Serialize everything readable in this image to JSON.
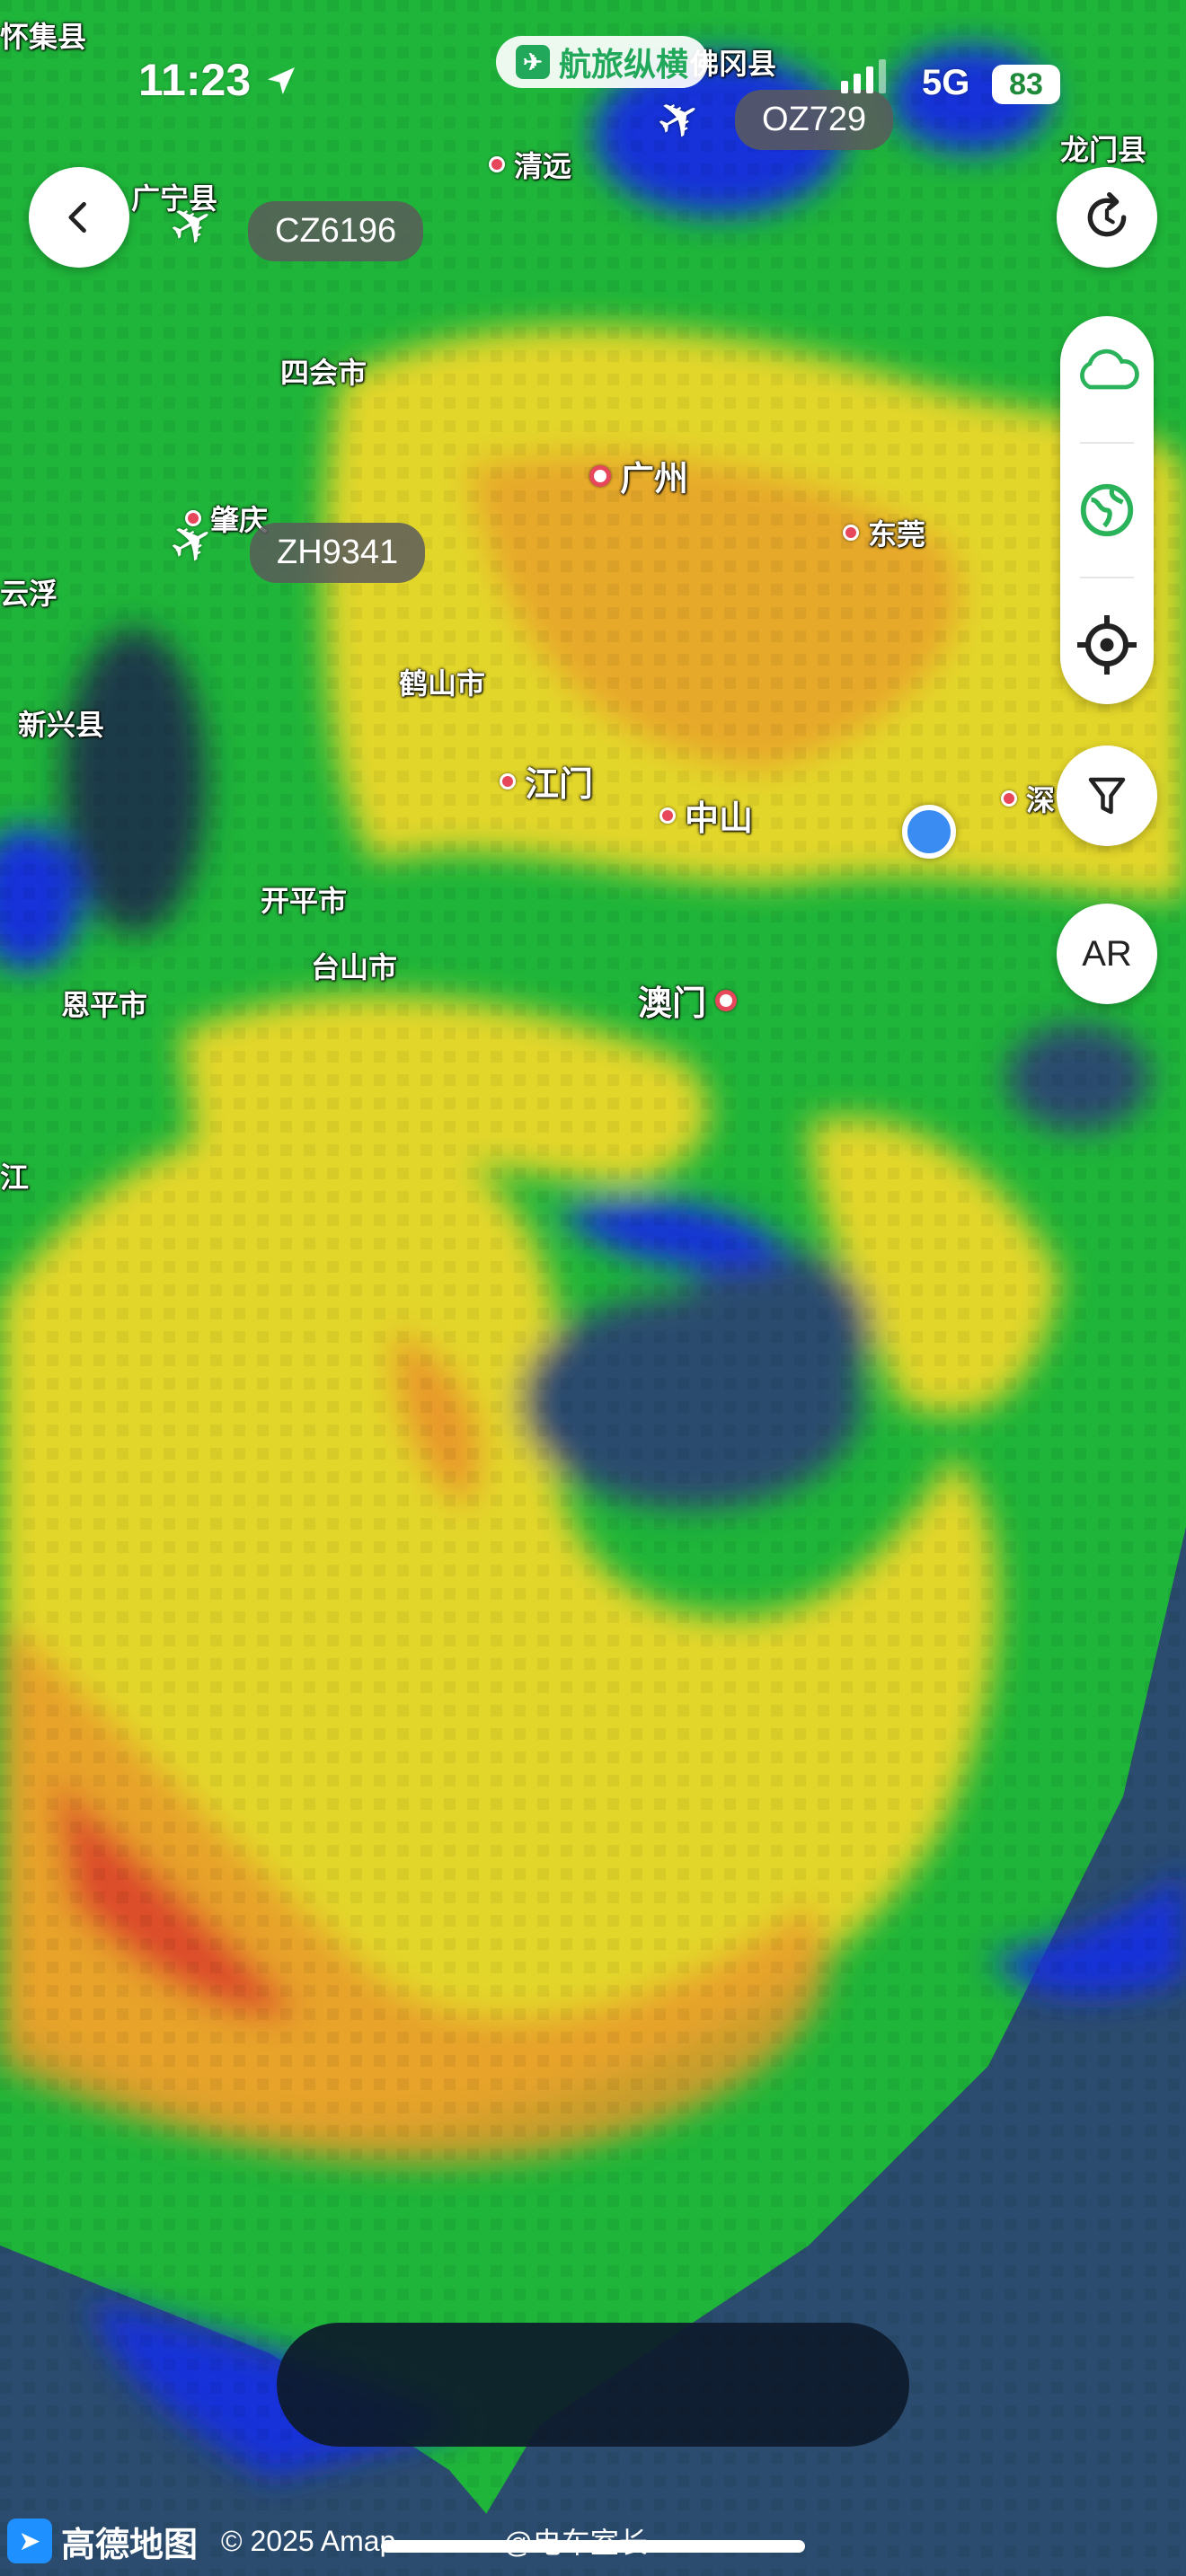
{
  "status_bar": {
    "time": "11:23",
    "network": "5G",
    "battery": "83"
  },
  "app_badge": "航旅纵横",
  "flights": [
    "OZ729",
    "CZ6196",
    "ZH9341"
  ],
  "cities": {
    "huaiji": "怀集县",
    "fogang": "佛冈县",
    "longmen": "龙门县",
    "guangning": "广宁县",
    "qingyuan": "清远",
    "sihui": "四会市",
    "guangzhou": "广州",
    "dongguan": "东莞",
    "zhaoqing": "肇庆",
    "yunfu": "云浮",
    "heshan": "鹤山市",
    "xinxing": "新兴县",
    "jiangmen": "江门",
    "zhongshan": "中山",
    "shenzhen": "深",
    "kaiping": "开平市",
    "taishan": "台山市",
    "enping": "恩平市",
    "jiang": "江",
    "macau": "澳门"
  },
  "controls": {
    "ar_label": "AR"
  },
  "footer": {
    "brand": "高德地图",
    "copyright": "© 2025 Amap",
    "watermark": "@电车室长"
  },
  "icons": [
    "back-arrow-icon",
    "location-arrow-icon",
    "refresh-icon",
    "cloud-icon",
    "globe-icon",
    "locate-icon",
    "filter-icon",
    "plane-icon"
  ],
  "colors": {
    "radar_green": "#1fb53a",
    "radar_yellow": "#e3d62b",
    "radar_orange": "#e89a2c",
    "radar_red": "#d9342b",
    "radar_blue": "#1230d8",
    "sea": "#2b4c6e"
  }
}
